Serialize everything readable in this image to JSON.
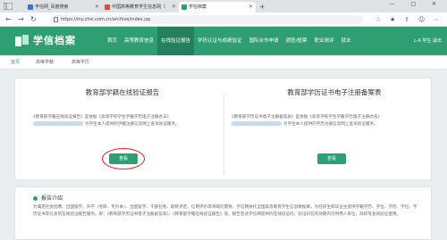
{
  "browser": {
    "tabs": [
      {
        "title": "学信网_百度搜索",
        "favicon_color": "#3b6fe0"
      },
      {
        "title": "中国高等教育学生信息网（",
        "favicon_color": "#e04c3c"
      },
      {
        "title": "学信档案",
        "favicon_color": "#2f9e73"
      }
    ],
    "new_tab": "+",
    "window_controls": "— □ ✕",
    "url": "https://my.chsi.com.cn/archive/index.jsp"
  },
  "site": {
    "logo_text": "学信档案",
    "nav": [
      {
        "label": "首页",
        "active": false
      },
      {
        "label": "高等教育信息",
        "active": false
      },
      {
        "label": "在线验证报告",
        "active": true
      },
      {
        "label": "学历认证与成绩验证",
        "active": false
      },
      {
        "label": "国际合作申请",
        "active": false
      },
      {
        "label": "调查/投票",
        "active": false
      },
      {
        "label": "职业测评",
        "active": false
      },
      {
        "label": "就业",
        "active": false
      }
    ],
    "user": "⌂ A 学生·退出"
  },
  "breadcrumb": [
    "首页",
    "高等学籍",
    "高等学历"
  ],
  "cards": {
    "left": {
      "title": "教育部学籍在线验证报告",
      "desc_a": "《教育部学籍在线验证报告》是依据《高等学校学生学籍学历电子注册办法》",
      "desc_b": "为学生本人提供的学籍注册信息网上查询验证服务。",
      "button": "查看"
    },
    "right": {
      "title": "教育部学历证书电子注册备案表",
      "desc_a": "《教育部学历证书电子注册备案表》是依据《高等学校学生学籍学历电子注册办法》",
      "desc_b": "为学生本人提供的学历注册信息网上查询验证服务。",
      "button": "查看"
    }
  },
  "intro": {
    "heading": "报告介绍",
    "text": "为满足社会招聘、出国留学、升学（考研、专升本）、出国留学、干部任免、职称评定、信用评价等领域的需要，学信网依托全国高等教育学生信息数据库，为在校生和毕业生提供学籍学历、学位、学历、学位、学历证书等信息的在线验证报告服务。即：《教育部学历证书电子注册备案表》、《教育部学籍在线验证报告》等。报告包含学信网提供的在线验证码，验证码在有效期内可供用人单位、高校等查询验证使用。"
  },
  "colors": {
    "brand": "#2f9e73",
    "highlight": "#e02222"
  }
}
